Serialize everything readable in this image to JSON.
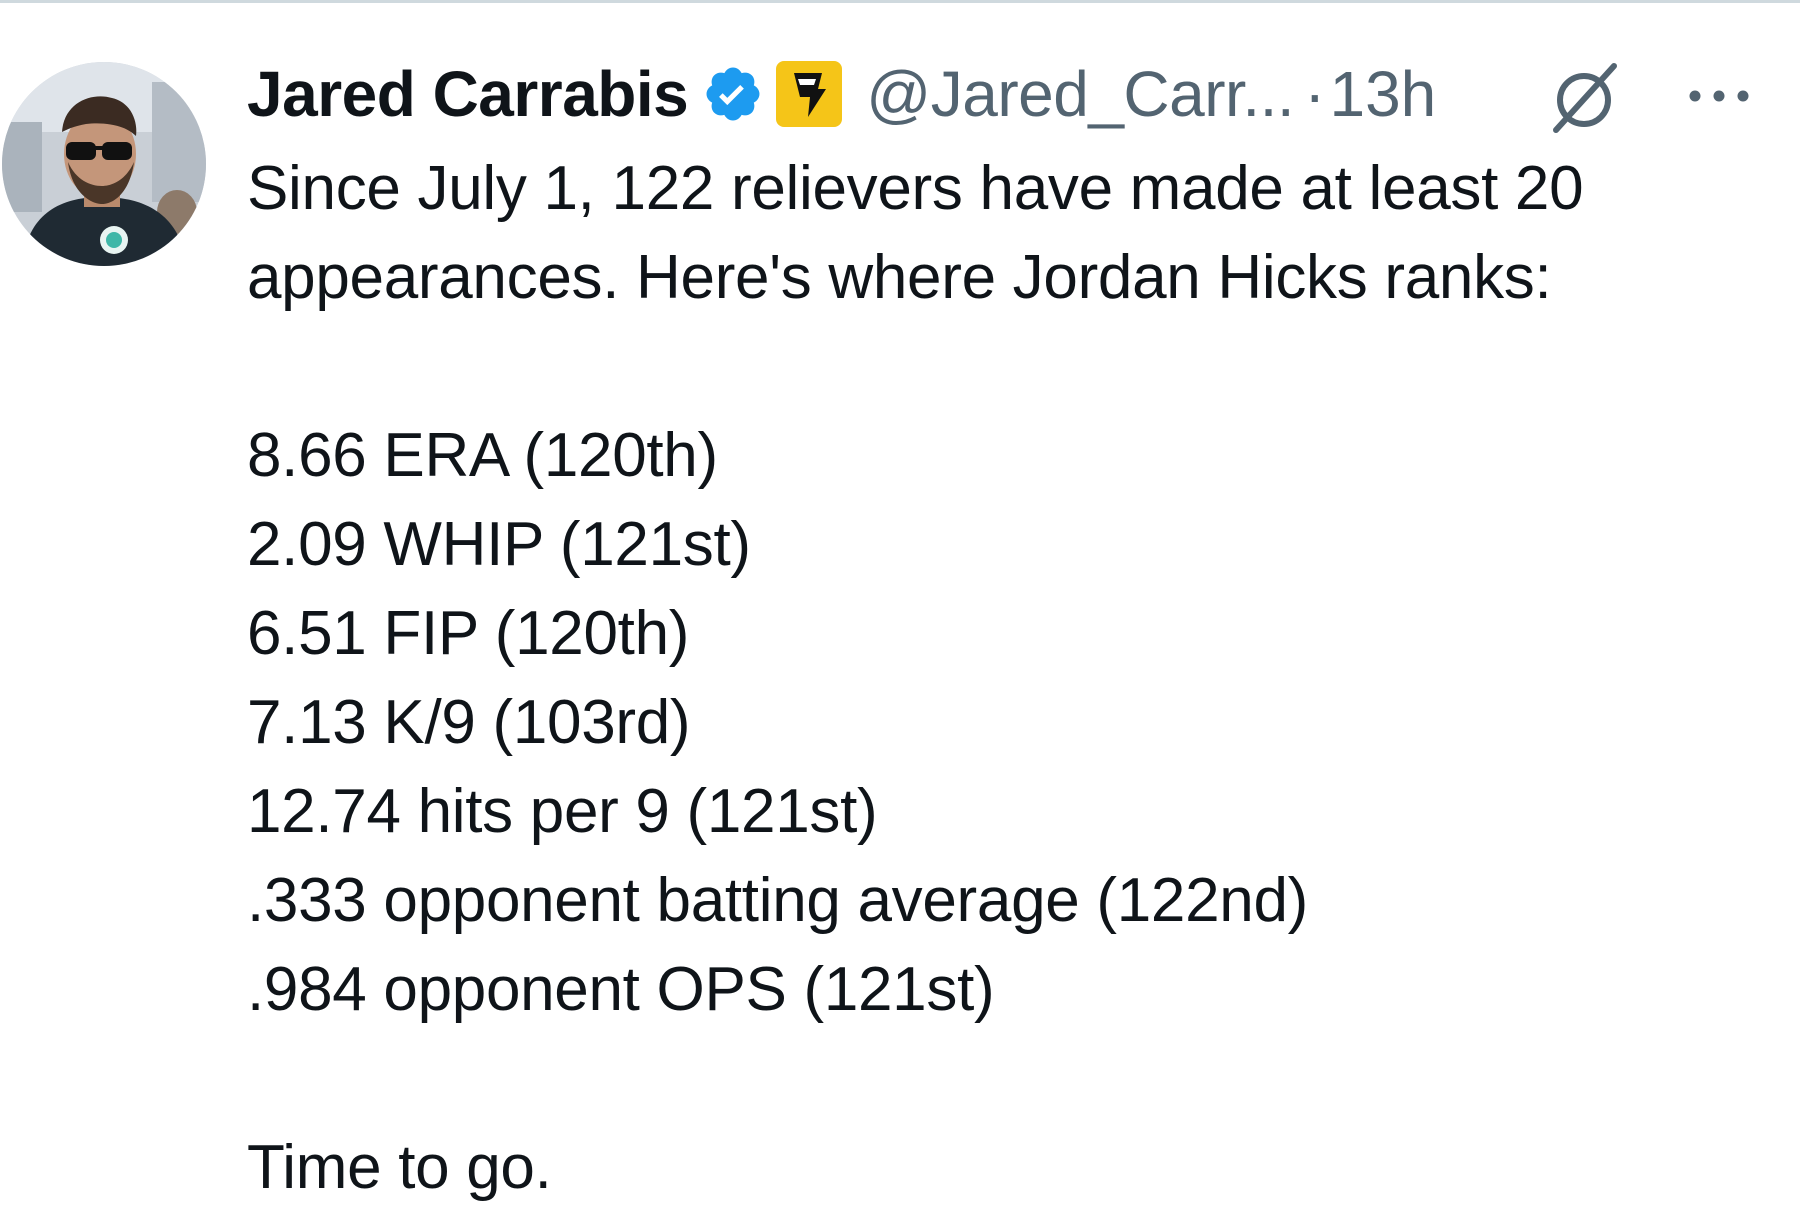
{
  "author": {
    "display_name": "Jared Carrabis",
    "handle": "@Jared_Carr...",
    "separator": "·",
    "timestamp": "13h",
    "verified_badge": "verified-checkmark-icon",
    "affiliate_badge": "affiliate-badge-icon"
  },
  "actions": {
    "grok_icon": "grok-icon",
    "more_icon": "more-options-icon"
  },
  "tweet": {
    "intro_lines": [
      "Since July 1, 122 relievers have made at least 20",
      "appearances. Here's where Jordan Hicks ranks:"
    ],
    "stats": [
      "8.66 ERA (120th)",
      "2.09 WHIP (121st)",
      "6.51 FIP (120th)",
      "7.13 K/9 (103rd)",
      "12.74 hits per 9 (121st)",
      ".333 opponent batting average (122nd)",
      ".984 opponent OPS (121st)"
    ],
    "closing": "Time to go."
  },
  "colors": {
    "text_primary": "#0f1419",
    "text_secondary": "#536471",
    "verified_blue": "#1d9bf0",
    "affiliate_gold": "#f5c518",
    "divider": "#cfd9de"
  }
}
